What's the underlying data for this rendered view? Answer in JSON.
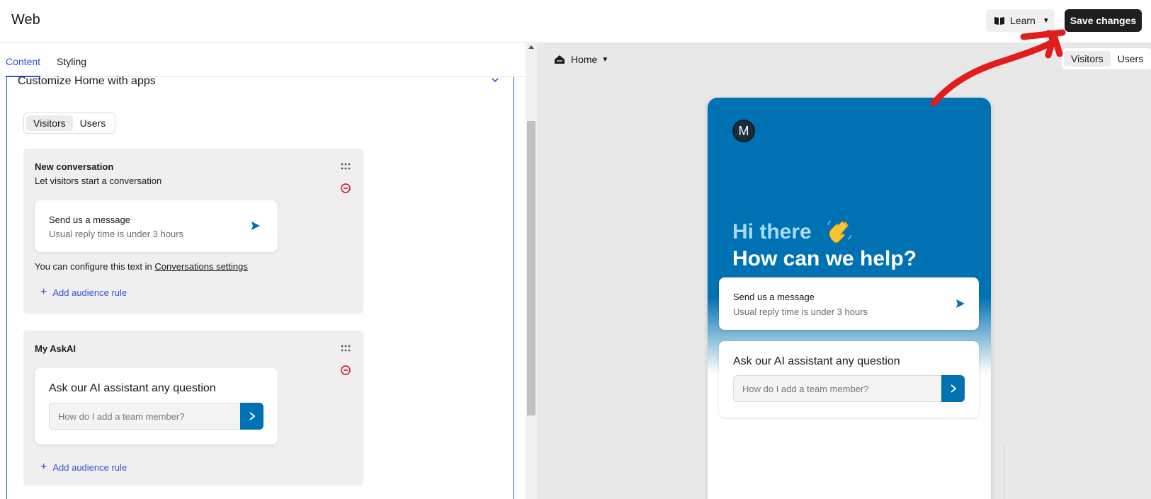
{
  "topbar": {
    "title": "Web",
    "learn_label": "Learn",
    "save_label": "Save changes"
  },
  "left": {
    "tabs": [
      {
        "label": "Content",
        "active": true
      },
      {
        "label": "Styling",
        "active": false
      }
    ],
    "section_title": "Customize Home with apps",
    "audience_toggle": [
      {
        "label": "Visitors",
        "selected": true
      },
      {
        "label": "Users",
        "selected": false
      }
    ],
    "cards": [
      {
        "title": "New conversation",
        "subtitle": "Let visitors start a conversation",
        "inner_title": "Send us a message",
        "inner_sub": "Usual reply time is under 3 hours",
        "config_text": "You can configure this text in ",
        "config_link": "Conversations settings",
        "add_rule": "Add audience rule"
      },
      {
        "title": "My AskAI",
        "inner_title": "Ask our AI assistant any question",
        "input_placeholder": "How do I add a team member?",
        "add_rule": "Add audience rule"
      }
    ]
  },
  "preview": {
    "page_select": "Home",
    "audience_toggle": [
      {
        "label": "Visitors",
        "selected": true
      },
      {
        "label": "Users",
        "selected": false
      }
    ],
    "avatar_letter": "M",
    "greeting": "Hi there",
    "greeting_emoji": "waving-hand",
    "headline": "How can we help?",
    "message_card": {
      "title": "Send us a message",
      "subtitle": "Usual reply time is under 3 hours"
    },
    "ai_card": {
      "title": "Ask our AI assistant any question",
      "placeholder": "How do I add a team member?"
    }
  },
  "colors": {
    "accent": "#3353d8",
    "brand": "#0071b2",
    "danger": "#d0021b",
    "annotation": "#e21b1b"
  }
}
